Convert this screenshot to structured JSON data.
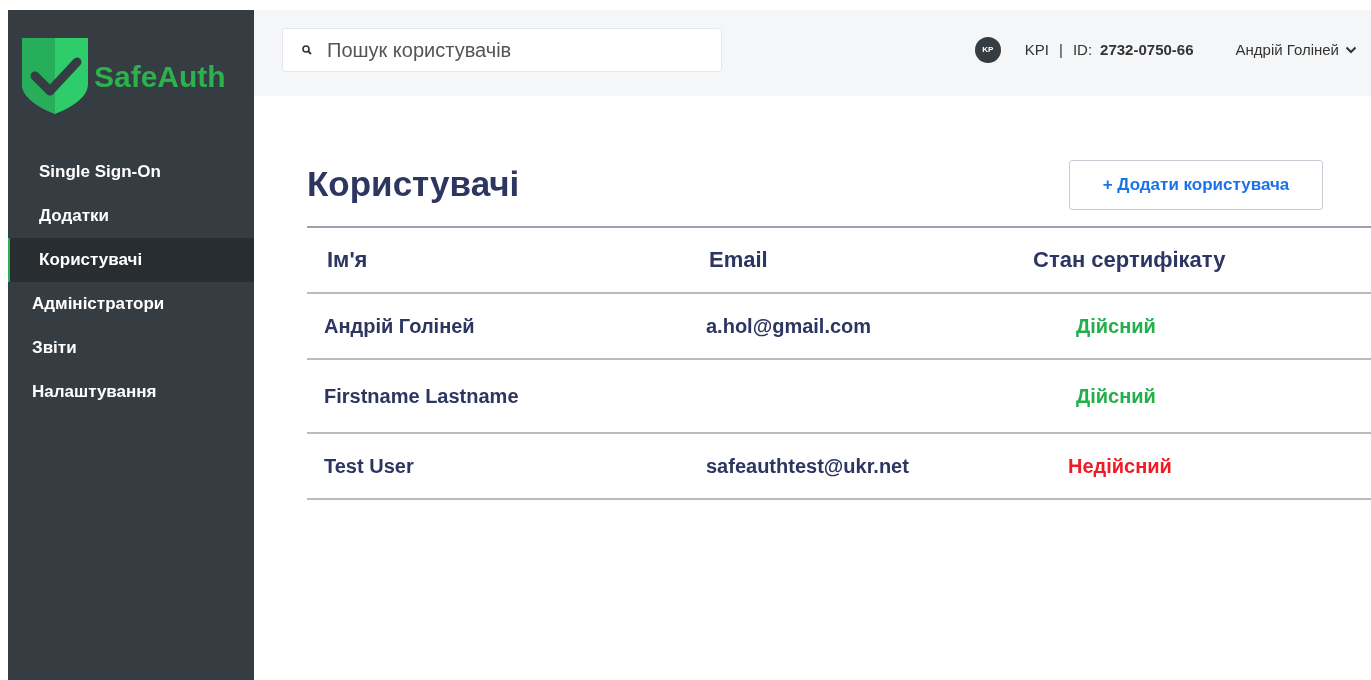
{
  "brand": {
    "name": "SafeAuth"
  },
  "sidebar": {
    "items": [
      {
        "label": "Single Sign-On",
        "selected": false,
        "nested": true
      },
      {
        "label": "Додатки",
        "selected": false,
        "nested": true
      },
      {
        "label": "Користувачі",
        "selected": true,
        "nested": true
      },
      {
        "label": "Адміністратори",
        "selected": false,
        "nested": false
      },
      {
        "label": "Звіти",
        "selected": false,
        "nested": false
      },
      {
        "label": "Налаштування",
        "selected": false,
        "nested": false
      }
    ]
  },
  "header": {
    "search": {
      "placeholder": "Пошук користувачів"
    },
    "org_avatar": "KP",
    "org": "KPI",
    "separator": "|",
    "id_label": "ID:",
    "id_value": "2732-0750-66",
    "user": "Андрій Голіней"
  },
  "page": {
    "title": "Користувачі",
    "add_button": "+ Додати користувача"
  },
  "table": {
    "columns": [
      "Ім'я",
      "Email",
      "Стан сертифікату"
    ],
    "rows": [
      {
        "name": "Андрій Голіней",
        "email": "a.hol@gmail.com",
        "status": "Дійсний",
        "valid": true
      },
      {
        "name": "Firstname Lastname",
        "email": "",
        "status": "Дійсний",
        "valid": true
      },
      {
        "name": "Test User",
        "email": "safeauthtest@ukr.net",
        "status": "Недійсний",
        "valid": false
      }
    ]
  }
}
